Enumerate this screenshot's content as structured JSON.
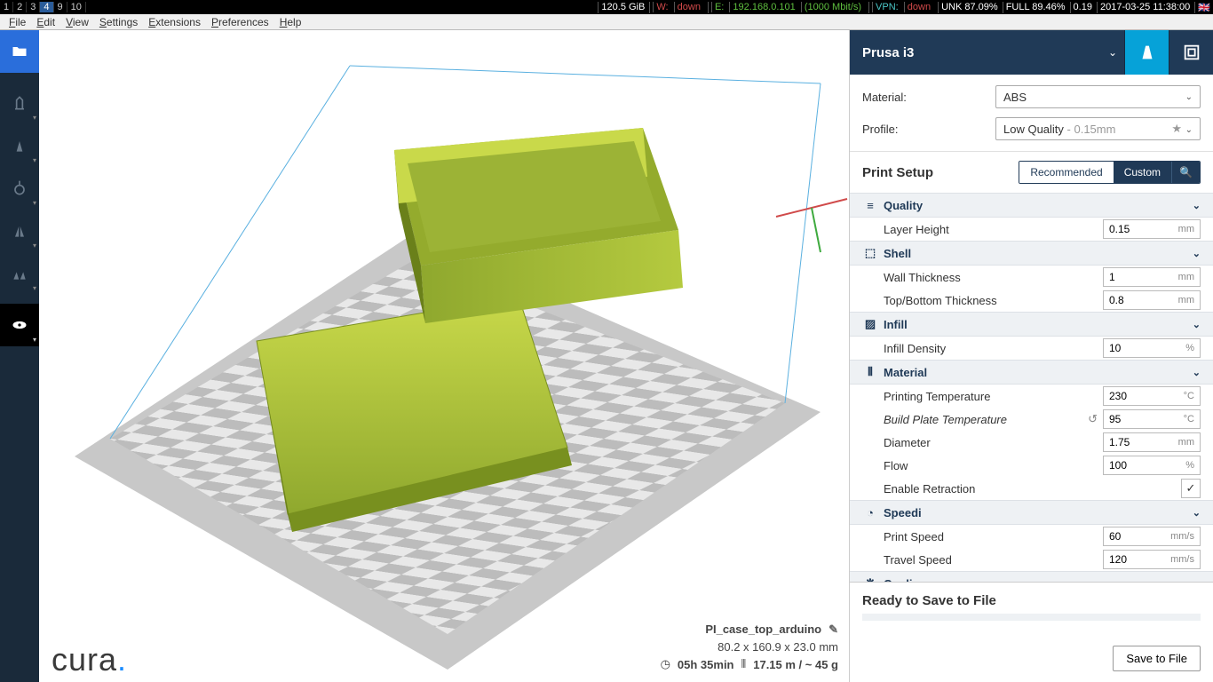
{
  "topbar": {
    "workspaces": [
      "1",
      "2",
      "3",
      "4",
      "9",
      "10"
    ],
    "active_ws": 3,
    "disk": "120.5 GiB",
    "w_label": "W:",
    "w_value": "down",
    "e_label": "E:",
    "e_ip": "192.168.0.101",
    "e_speed": "(1000 Mbit/s)",
    "vpn_label": "VPN:",
    "vpn_value": "down",
    "unk": "UNK 87.09%",
    "full": "FULL 89.46%",
    "load": "0.19",
    "datetime": "2017-03-25 11:38:00"
  },
  "menubar": [
    "File",
    "Edit",
    "View",
    "Settings",
    "Extensions",
    "Preferences",
    "Help"
  ],
  "printer": "Prusa i3",
  "material_label": "Material:",
  "material_value": "ABS",
  "profile_label": "Profile:",
  "profile_value": "Low Quality",
  "profile_suffix": " - 0.15mm",
  "setup_title": "Print Setup",
  "seg_rec": "Recommended",
  "seg_cus": "Custom",
  "cats": {
    "quality": "Quality",
    "shell": "Shell",
    "infill": "Infill",
    "material": "Material",
    "speed": "Speed",
    "cooling": "Cooling"
  },
  "props": {
    "layer_height": {
      "label": "Layer Height",
      "value": "0.15",
      "unit": "mm"
    },
    "wall_thickness": {
      "label": "Wall Thickness",
      "value": "1",
      "unit": "mm"
    },
    "topbottom": {
      "label": "Top/Bottom Thickness",
      "value": "0.8",
      "unit": "mm"
    },
    "infill_density": {
      "label": "Infill Density",
      "value": "10",
      "unit": "%"
    },
    "print_temp": {
      "label": "Printing Temperature",
      "value": "230",
      "unit": "°C"
    },
    "bed_temp": {
      "label": "Build Plate Temperature",
      "value": "95",
      "unit": "°C"
    },
    "diameter": {
      "label": "Diameter",
      "value": "1.75",
      "unit": "mm"
    },
    "flow": {
      "label": "Flow",
      "value": "100",
      "unit": "%"
    },
    "retraction": {
      "label": "Enable Retraction"
    },
    "print_speed": {
      "label": "Print Speed",
      "value": "60",
      "unit": "mm/s"
    },
    "travel_speed": {
      "label": "Travel Speed",
      "value": "120",
      "unit": "mm/s"
    }
  },
  "object": {
    "name": "PI_case_top_arduino",
    "dimensions": "80.2 x 160.9 x 23.0 mm",
    "time": "05h 35min",
    "filament": "17.15 m / ~ 45 g"
  },
  "ready": "Ready to Save to File",
  "save": "Save to File",
  "logo": "cura"
}
